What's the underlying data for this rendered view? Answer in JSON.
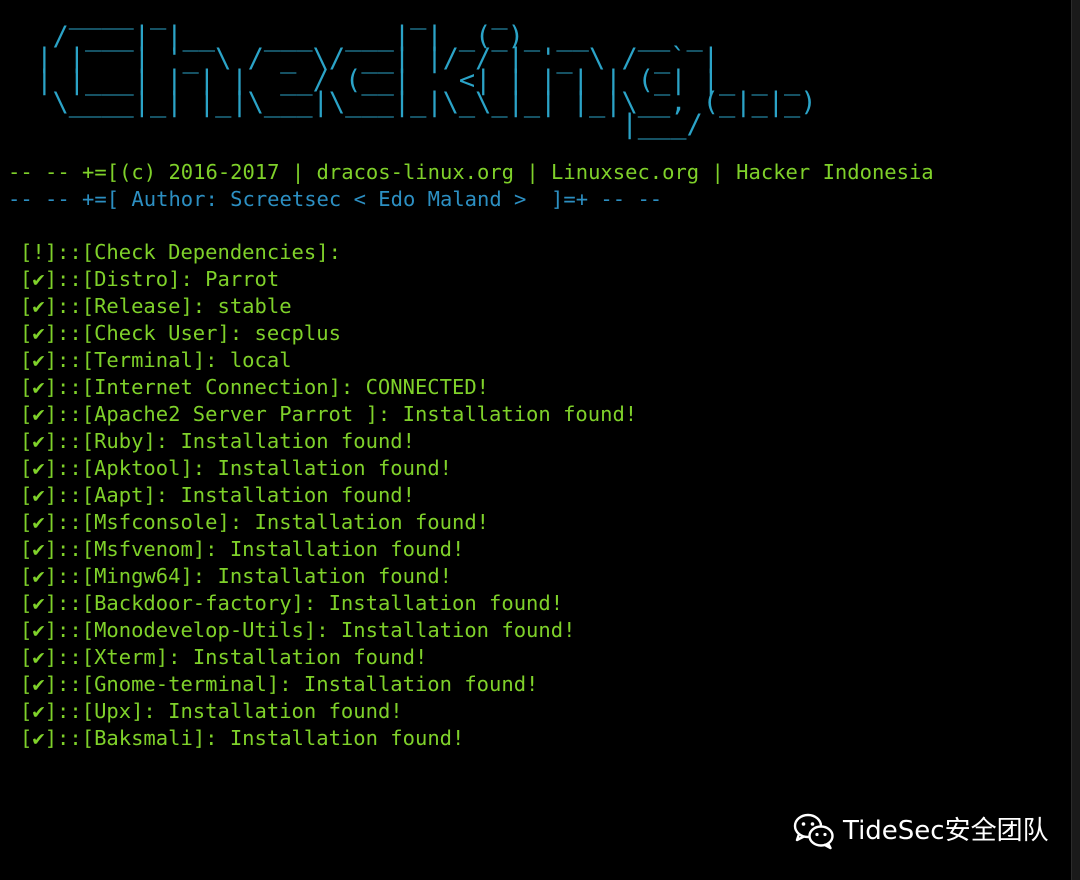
{
  "banner": {
    "ascii_art": "   ____ _               _    _               \n  / ___| |__   ___  ___| | _(_)_ __   __ _   \n | |   | '_ \\ / _ \\/ __| |/ / | '_ \\ / _` |  \n | |___| | | |  __/ (__|   <| | | | | (_| |_ _ _\n  \\____|_| |_|\\___|\\___|_|\\_\\_|_| |_|\\__, (_|_|_)\n                                     |___/"
  },
  "credits": {
    "line1": "-- -- +=[(c) 2016-2017 | dracos-linux.org | Linuxsec.org | Hacker Indonesia",
    "line2": "-- -- +=[ Author: Screetsec < Edo Maland >  ]=+ -- --"
  },
  "checks": [
    {
      "mark": "!",
      "label": "Check Dependencies",
      "value": ""
    },
    {
      "mark": "✔",
      "label": "Distro",
      "value": "Parrot"
    },
    {
      "mark": "✔",
      "label": "Release",
      "value": "stable"
    },
    {
      "mark": "✔",
      "label": "Check User",
      "value": "secplus"
    },
    {
      "mark": "✔",
      "label": "Terminal",
      "value": "local"
    },
    {
      "mark": "✔",
      "label": "Internet Connection",
      "value": "CONNECTED!"
    },
    {
      "mark": "✔",
      "label": "Apache2 Server Parrot ",
      "value": "Installation found!"
    },
    {
      "mark": "✔",
      "label": "Ruby",
      "value": "Installation found!"
    },
    {
      "mark": "✔",
      "label": "Apktool",
      "value": "Installation found!"
    },
    {
      "mark": "✔",
      "label": "Aapt",
      "value": "Installation found!"
    },
    {
      "mark": "✔",
      "label": "Msfconsole",
      "value": "Installation found!"
    },
    {
      "mark": "✔",
      "label": "Msfvenom",
      "value": "Installation found!"
    },
    {
      "mark": "✔",
      "label": "Mingw64",
      "value": "Installation found!"
    },
    {
      "mark": "✔",
      "label": "Backdoor-factory",
      "value": "Installation found!"
    },
    {
      "mark": "✔",
      "label": "Monodevelop-Utils",
      "value": "Installation found!"
    },
    {
      "mark": "✔",
      "label": "Xterm",
      "value": "Installation found!"
    },
    {
      "mark": "✔",
      "label": "Gnome-terminal",
      "value": "Installation found!"
    },
    {
      "mark": "✔",
      "label": "Upx",
      "value": "Installation found!"
    },
    {
      "mark": "✔",
      "label": "Baksmali",
      "value": "Installation found!"
    }
  ],
  "watermark": {
    "icon": "wechat-icon",
    "text": "TideSec安全团队"
  },
  "colors": {
    "background": "#000000",
    "banner": "#2ba3c7",
    "check_text": "#7fd12a",
    "author_line": "#2c8fc2",
    "watermark": "#ffffff"
  }
}
